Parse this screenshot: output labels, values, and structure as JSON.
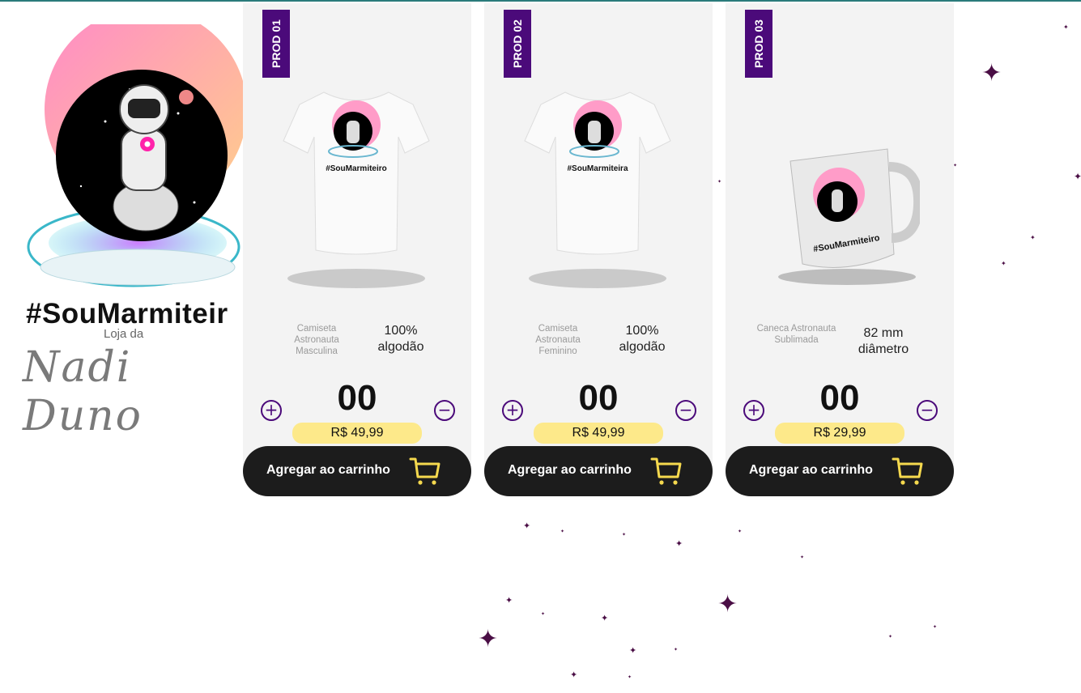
{
  "brand": {
    "hashtag": "#SouMarmiteir",
    "loja": "Loja da",
    "signature": "Nadi Duno"
  },
  "products": [
    {
      "tag": "PROD 01",
      "image_icon": "tshirt-image",
      "image_caption": "#SouMarmiteiro",
      "description": "Camiseta Astronauta Masculina",
      "spec": "100% algodão",
      "quantity": "00",
      "price": "R$ 49,99",
      "cart_label": "Agregar ao carrinho"
    },
    {
      "tag": "PROD 02",
      "image_icon": "tshirt-image",
      "image_caption": "#SouMarmiteira",
      "description": "Camiseta Astronauta Feminino",
      "spec": "100% algodão",
      "quantity": "00",
      "price": "R$ 49,99",
      "cart_label": "Agregar ao carrinho"
    },
    {
      "tag": "PROD 03",
      "image_icon": "mug-image",
      "image_caption": "#SouMarmiteiro",
      "description": "Caneca Astronauta Sublimada",
      "spec": "82 mm diâmetro",
      "quantity": "00",
      "price": "R$ 29,99",
      "cart_label": "Agregar ao carrinho"
    }
  ],
  "colors": {
    "accent_purple": "#4b0a7a",
    "price_bg": "#fde98a",
    "cart_bg": "#1c1c1c",
    "cart_icon": "#f5d94e",
    "card_bg": "#f3f3f3",
    "star": "#4a0e45"
  }
}
